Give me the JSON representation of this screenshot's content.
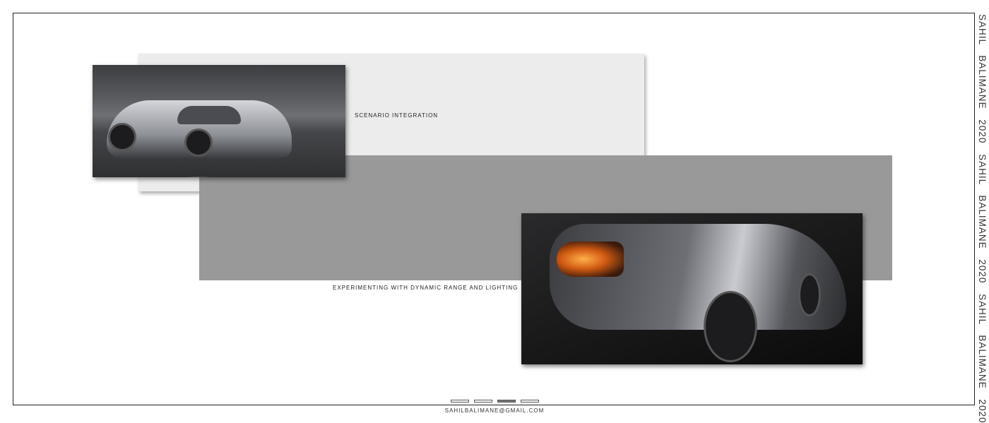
{
  "side_text": "SAHIL BALIMANE 2020  SAHIL BALIMANE 2020  SAHIL BALIMANE 2020",
  "captions": {
    "scenario": "SCENARIO INTEGRATION",
    "lighting": "EXPERIMENTING WITH DYNAMIC RANGE AND LIGHTING"
  },
  "pagination": {
    "total": 4,
    "current": 3
  },
  "email": "SAHILBALIMANE@GMAIL.COM",
  "colors": {
    "panel_light": "#ececec",
    "panel_gray": "#999999",
    "tail_light": "#ff8a2a"
  }
}
